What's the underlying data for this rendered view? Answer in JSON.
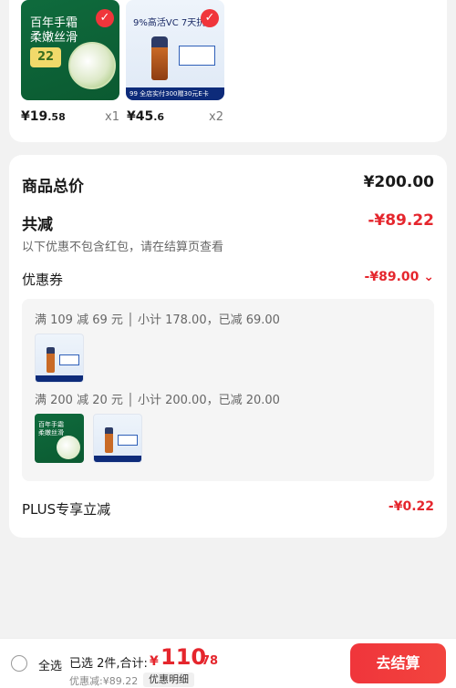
{
  "cart_items": [
    {
      "price_main": "¥19",
      "price_decimal": ".58",
      "qty": "x1",
      "thumb_title": "百年手霜\n柔嫩丝滑",
      "thumb_badge": "22"
    },
    {
      "price_main": "¥45",
      "price_decimal": ".6",
      "qty": "x2",
      "thumb_title": "9%高活VC 7天抗氧",
      "thumb_strip": "99 全店实付300赠30元E卡"
    }
  ],
  "summary": {
    "total_label": "商品总价",
    "total_value": "¥200.00",
    "reduce_label": "共减",
    "reduce_value": "-¥89.22",
    "note": "以下优惠不包含红包，请在结算页查看",
    "coupon_label": "优惠券",
    "coupon_value": "-¥89.00 ⌄",
    "coupon_rules": [
      "满 109 减 69 元 │ 小计 178.00，已减 69.00",
      "满 200 减 20 元 │ 小计 200.00，已减 20.00"
    ],
    "mini_green_title": "百年手霜\n柔嫩丝滑",
    "plus_label": "PLUS专享立减",
    "plus_value": "-¥0.22"
  },
  "bottom_bar": {
    "select_all": "全选",
    "selected": "已选 2件,合计:",
    "yen": "¥",
    "total_int": "110",
    "total_dec": ".78",
    "discount": "优惠减:¥89.22",
    "detail": "优惠明细",
    "checkout": "去结算"
  }
}
